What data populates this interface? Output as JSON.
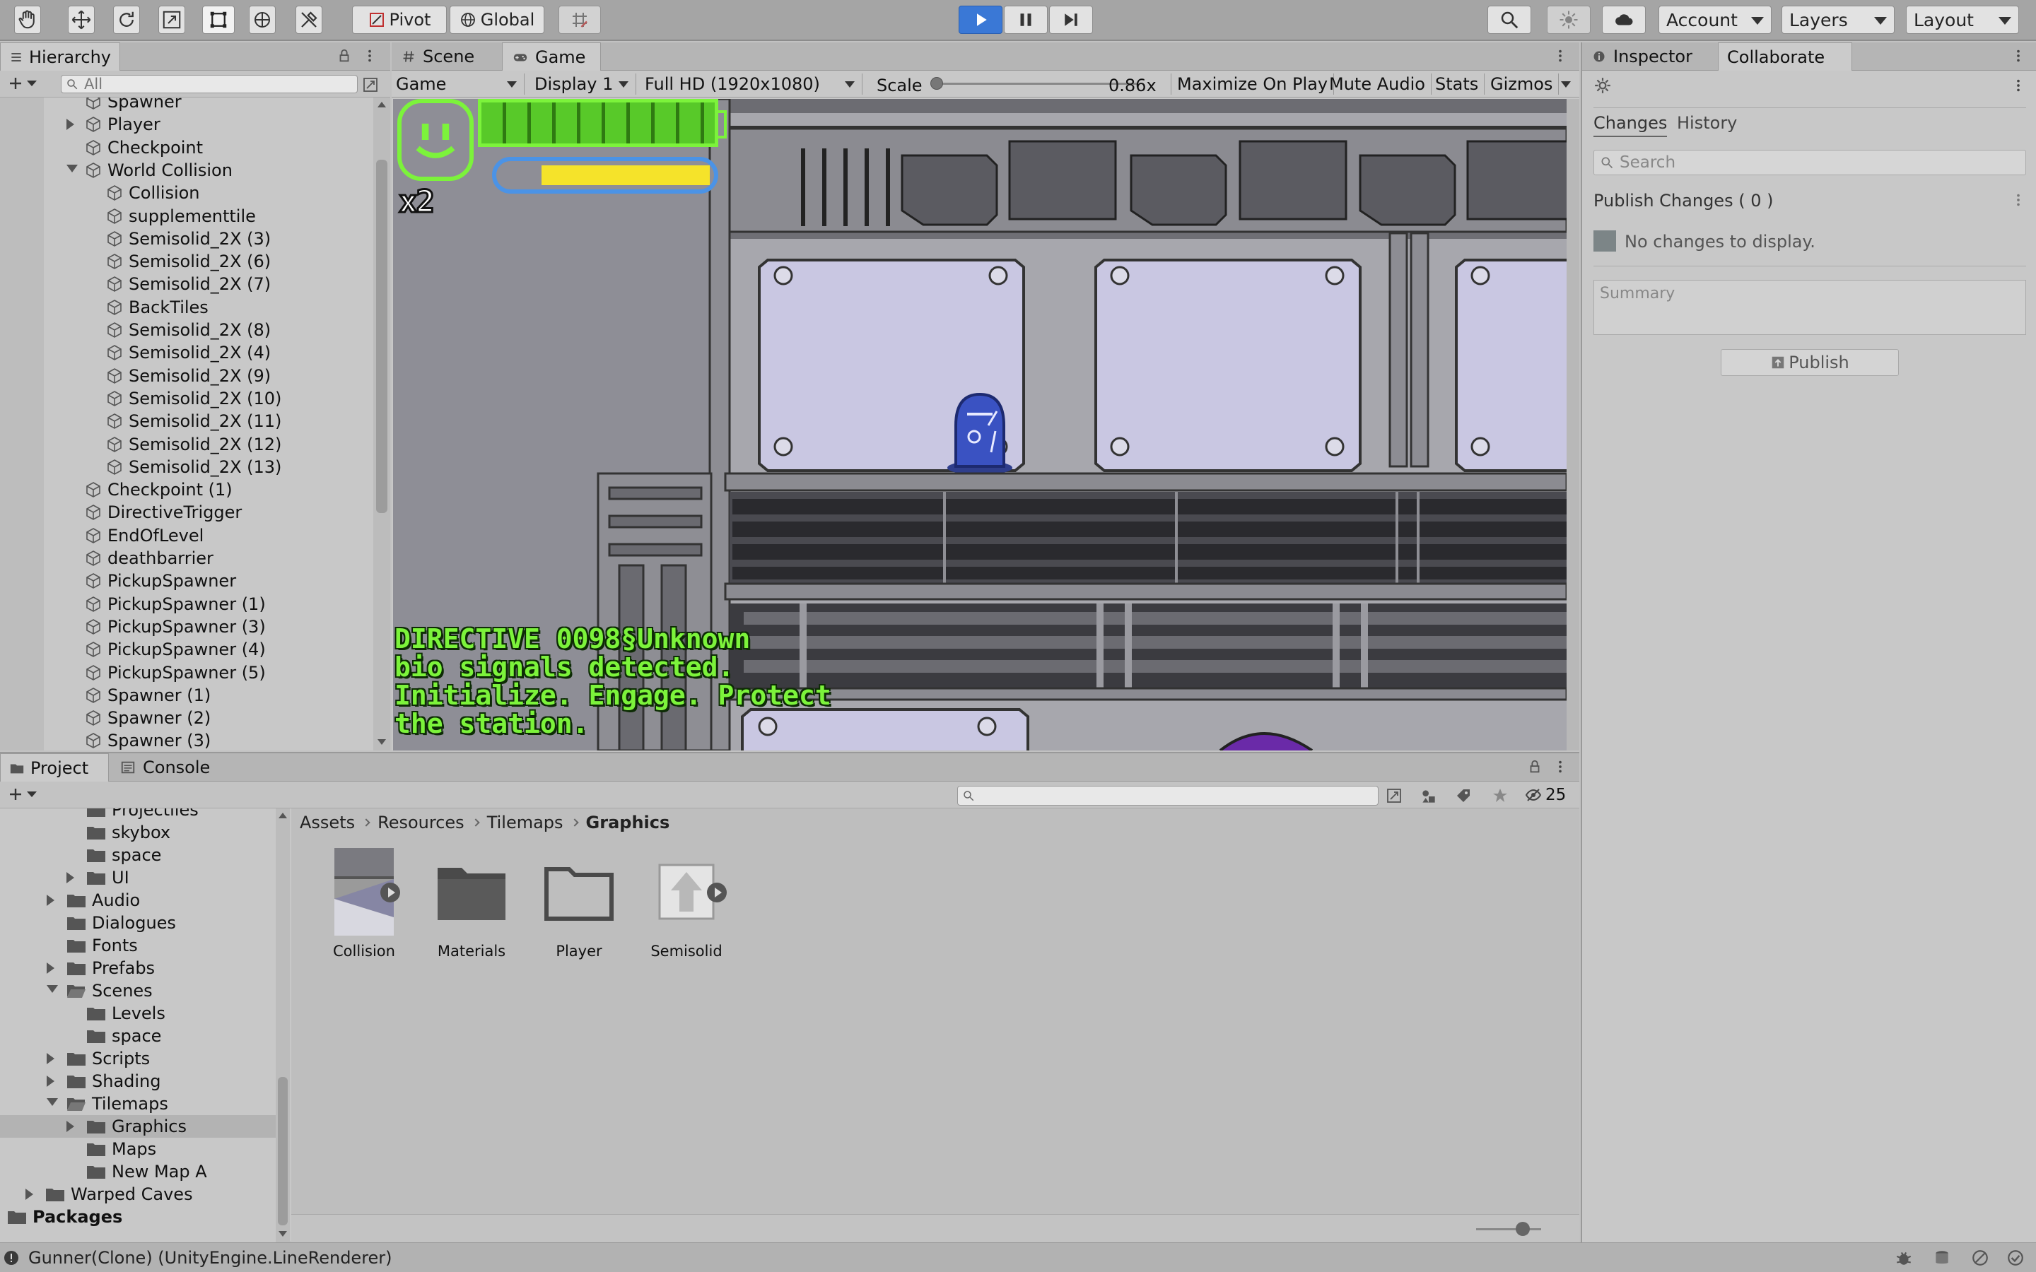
{
  "toolbar": {
    "pivot_label": "Pivot",
    "global_label": "Global",
    "account_label": "Account",
    "layers_label": "Layers",
    "layout_label": "Layout"
  },
  "hierarchy": {
    "title": "Hierarchy",
    "search_placeholder": "All",
    "items": [
      {
        "label": "Spawner",
        "depth": 1,
        "expand": "none"
      },
      {
        "label": "Player",
        "depth": 1,
        "expand": "closed"
      },
      {
        "label": "Checkpoint",
        "depth": 1,
        "expand": "none"
      },
      {
        "label": "World Collision",
        "depth": 1,
        "expand": "open"
      },
      {
        "label": "Collision",
        "depth": 2,
        "expand": "none"
      },
      {
        "label": "supplementtile",
        "depth": 2,
        "expand": "none"
      },
      {
        "label": "Semisolid_2X (3)",
        "depth": 2,
        "expand": "none"
      },
      {
        "label": "Semisolid_2X (6)",
        "depth": 2,
        "expand": "none"
      },
      {
        "label": "Semisolid_2X (7)",
        "depth": 2,
        "expand": "none"
      },
      {
        "label": "BackTiles",
        "depth": 2,
        "expand": "none"
      },
      {
        "label": "Semisolid_2X (8)",
        "depth": 2,
        "expand": "none"
      },
      {
        "label": "Semisolid_2X (4)",
        "depth": 2,
        "expand": "none"
      },
      {
        "label": "Semisolid_2X (9)",
        "depth": 2,
        "expand": "none"
      },
      {
        "label": "Semisolid_2X (10)",
        "depth": 2,
        "expand": "none"
      },
      {
        "label": "Semisolid_2X (11)",
        "depth": 2,
        "expand": "none"
      },
      {
        "label": "Semisolid_2X (12)",
        "depth": 2,
        "expand": "none"
      },
      {
        "label": "Semisolid_2X (13)",
        "depth": 2,
        "expand": "none"
      },
      {
        "label": "Checkpoint (1)",
        "depth": 1,
        "expand": "none"
      },
      {
        "label": "DirectiveTrigger",
        "depth": 1,
        "expand": "none"
      },
      {
        "label": "EndOfLevel",
        "depth": 1,
        "expand": "none"
      },
      {
        "label": "deathbarrier",
        "depth": 1,
        "expand": "none"
      },
      {
        "label": "PickupSpawner",
        "depth": 1,
        "expand": "none"
      },
      {
        "label": "PickupSpawner (1)",
        "depth": 1,
        "expand": "none"
      },
      {
        "label": "PickupSpawner (3)",
        "depth": 1,
        "expand": "none"
      },
      {
        "label": "PickupSpawner (4)",
        "depth": 1,
        "expand": "none"
      },
      {
        "label": "PickupSpawner (5)",
        "depth": 1,
        "expand": "none"
      },
      {
        "label": "Spawner (1)",
        "depth": 1,
        "expand": "none"
      },
      {
        "label": "Spawner (2)",
        "depth": 1,
        "expand": "none"
      },
      {
        "label": "Spawner (3)",
        "depth": 1,
        "expand": "none"
      }
    ]
  },
  "game": {
    "tabs": {
      "scene": "Scene",
      "game": "Game"
    },
    "mode": "Game",
    "display": "Display 1",
    "resolution": "Full HD (1920x1080)",
    "scale_label": "Scale",
    "scale_value": "0.86x",
    "scale_fraction": 0.0,
    "maximize": "Maximize On Play",
    "mute": "Mute Audio",
    "stats": "Stats",
    "gizmos": "Gizmos",
    "lives": "x2",
    "health_fraction": 1.0,
    "energy_fraction": 0.88,
    "directive_lines": [
      "DIRECTIVE 0098§Unknown",
      "bio signals detected.",
      "Initialize. Engage. Protect",
      "the station."
    ]
  },
  "inspector": {
    "tab_inspector": "Inspector",
    "tab_collaborate": "Collaborate",
    "subtab_changes": "Changes",
    "subtab_history": "History",
    "search_placeholder": "Search",
    "publish_changes": "Publish Changes ( 0 )",
    "no_changes": "No changes to display.",
    "summary_placeholder": "Summary",
    "publish_button": "Publish"
  },
  "project": {
    "tab_project": "Project",
    "tab_console": "Console",
    "hidden_count": "25",
    "tree": [
      {
        "label": "Projectiles",
        "depth": 3,
        "expand": "none"
      },
      {
        "label": "skybox",
        "depth": 3,
        "expand": "none"
      },
      {
        "label": "space",
        "depth": 3,
        "expand": "none"
      },
      {
        "label": "UI",
        "depth": 3,
        "expand": "closed"
      },
      {
        "label": "Audio",
        "depth": 2,
        "expand": "closed"
      },
      {
        "label": "Dialogues",
        "depth": 2,
        "expand": "none"
      },
      {
        "label": "Fonts",
        "depth": 2,
        "expand": "none"
      },
      {
        "label": "Prefabs",
        "depth": 2,
        "expand": "closed"
      },
      {
        "label": "Scenes",
        "depth": 2,
        "expand": "open"
      },
      {
        "label": "Levels",
        "depth": 3,
        "expand": "none"
      },
      {
        "label": "space",
        "depth": 3,
        "expand": "none"
      },
      {
        "label": "Scripts",
        "depth": 2,
        "expand": "closed"
      },
      {
        "label": "Shading",
        "depth": 2,
        "expand": "closed"
      },
      {
        "label": "Tilemaps",
        "depth": 2,
        "expand": "open"
      },
      {
        "label": "Graphics",
        "depth": 3,
        "expand": "closed",
        "selected": true
      },
      {
        "label": "Maps",
        "depth": 3,
        "expand": "none"
      },
      {
        "label": "New Map A",
        "depth": 3,
        "expand": "none"
      },
      {
        "label": "Warped Caves",
        "depth": 1,
        "expand": "closed"
      },
      {
        "label": "Packages",
        "depth": 0,
        "expand": "closed",
        "bold": true
      }
    ],
    "breadcrumb": [
      "Assets",
      "Resources",
      "Tilemaps",
      "Graphics"
    ],
    "assets": [
      {
        "label": "Collision",
        "kind": "tilemap-sprite"
      },
      {
        "label": "Materials",
        "kind": "folder"
      },
      {
        "label": "Player",
        "kind": "folder-empty"
      },
      {
        "label": "Semisolid",
        "kind": "prefab-sprite"
      }
    ]
  },
  "status": {
    "message": "Gunner(Clone) (UnityEngine.LineRenderer)"
  },
  "colors": {
    "play_blue": "#3a78d6",
    "hud_green": "#7cf33b",
    "hud_yellow": "#f5e32a",
    "hud_blue": "#4b93e6",
    "selection": "#b3b3b3",
    "game_bg": "#8e8e96"
  }
}
